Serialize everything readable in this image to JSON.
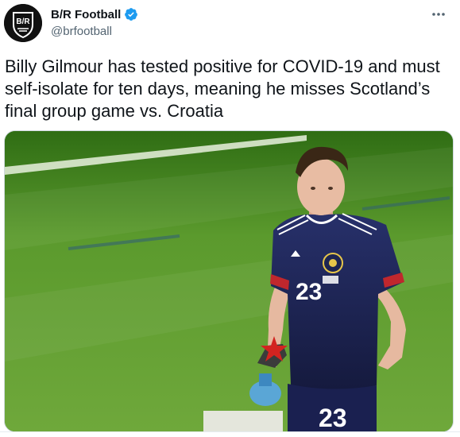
{
  "author": {
    "name": "B/R Football",
    "handle": "@brfootball",
    "verified": true,
    "avatar_icon": "br-logo-icon"
  },
  "tweet": {
    "text": "Billy Gilmour has tested positive for COVID-19 and must self-isolate for ten days, meaning he misses Scotland’s final group game vs. Croatia"
  },
  "media": {
    "description_icon": "player-photo",
    "shirt_number": "23"
  },
  "colors": {
    "verified_badge": "#1d9bf0",
    "text_primary": "#0f1419",
    "text_secondary": "#536471",
    "pitch_green": "#4e8b25",
    "kit_navy": "#1d2552"
  },
  "icons": {
    "more": "more-options-icon",
    "verified": "verified-badge-icon"
  }
}
